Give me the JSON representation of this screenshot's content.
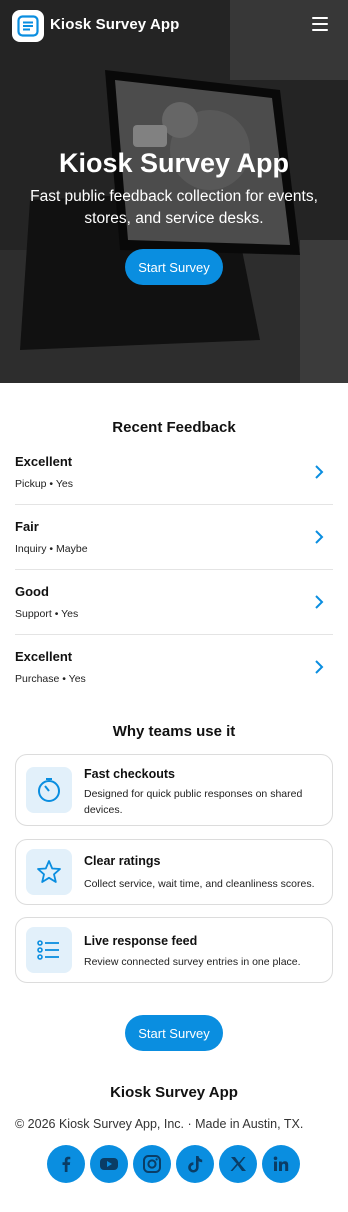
{
  "header": {
    "brand": "Kiosk Survey App",
    "logo_icon": "survey-form-icon",
    "menu_icon": "hamburger-icon"
  },
  "hero": {
    "title": "Kiosk Survey App",
    "subtitle": "Fast public feedback collection for events, stores, and service desks.",
    "cta_label": "Start Survey"
  },
  "recent_feedback": {
    "heading": "Recent Feedback",
    "items": [
      {
        "rating": "Excellent",
        "meta": "Pickup • Yes"
      },
      {
        "rating": "Fair",
        "meta": "Inquiry • Maybe"
      },
      {
        "rating": "Good",
        "meta": "Support • Yes"
      },
      {
        "rating": "Excellent",
        "meta": "Purchase • Yes"
      }
    ]
  },
  "why": {
    "heading": "Why teams use it",
    "features": [
      {
        "icon": "timer-icon",
        "title": "Fast checkouts",
        "desc": "Designed for quick public responses on shared devices."
      },
      {
        "icon": "star-icon",
        "title": "Clear ratings",
        "desc": "Collect service, wait time, and cleanliness scores."
      },
      {
        "icon": "list-icon",
        "title": "Live response feed",
        "desc": "Review connected survey entries in one place."
      }
    ]
  },
  "cta_bottom": {
    "label": "Start Survey"
  },
  "footer": {
    "brand": "Kiosk Survey App",
    "copyright": "© 2026 Kiosk Survey App, Inc. · Made in Austin, TX.",
    "socials": [
      "facebook-icon",
      "youtube-icon",
      "instagram-icon",
      "tiktok-icon",
      "x-icon",
      "linkedin-icon"
    ]
  },
  "colors": {
    "accent": "#0a8ee0",
    "icon_bg": "#e2f0fa",
    "text": "#111111"
  }
}
